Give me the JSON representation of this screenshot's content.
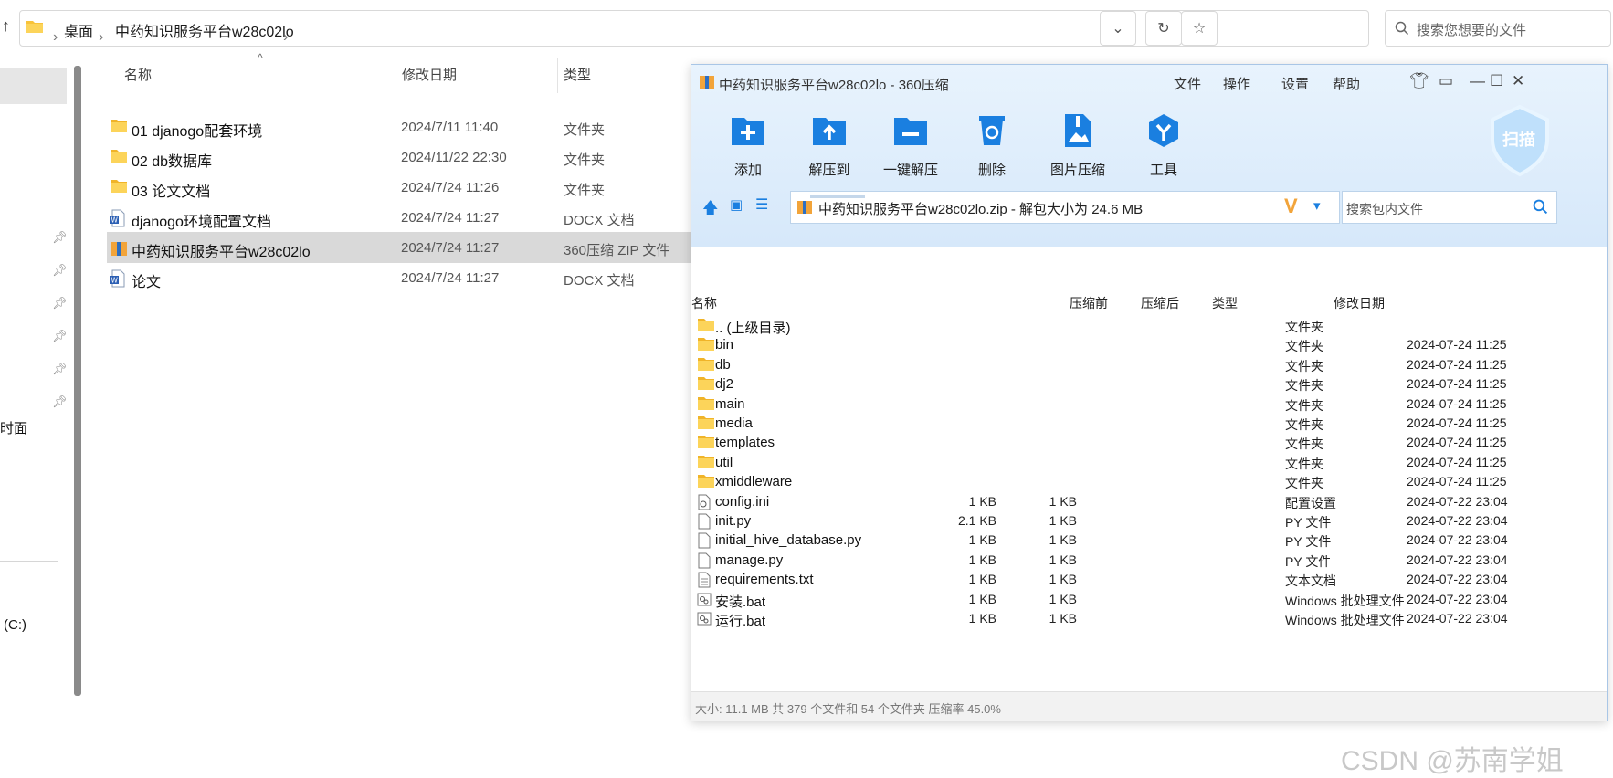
{
  "explorer": {
    "breadcrumb": [
      "桌面",
      "中药知识服务平台w28c02lo"
    ],
    "search_placeholder": "搜索您想要的文件",
    "columns": {
      "name": "名称",
      "date": "修改日期",
      "type": "类型"
    },
    "files": [
      {
        "name": "01 djanogo配套环境",
        "date": "2024/7/11 11:40",
        "type": "文件夹",
        "icon": "folder-icon"
      },
      {
        "name": "02 db数据库",
        "date": "2024/11/22 22:30",
        "type": "文件夹",
        "icon": "folder-icon"
      },
      {
        "name": "03 论文文档",
        "date": "2024/7/24 11:26",
        "type": "文件夹",
        "icon": "folder-icon"
      },
      {
        "name": "djanogo环境配置文档",
        "date": "2024/7/24 11:27",
        "type": "DOCX 文档",
        "icon": "word-doc-icon"
      },
      {
        "name": "中药知识服务平台w28c02lo",
        "date": "2024/7/24 11:27",
        "type": "360压缩 ZIP 文件",
        "icon": "zip-archive-icon",
        "selected": true
      },
      {
        "name": "论文",
        "date": "2024/7/24 11:27",
        "type": "DOCX 文档",
        "icon": "word-doc-icon"
      }
    ],
    "sidebar_fragments": [
      "时面",
      "(C:)"
    ]
  },
  "zip": {
    "title": "中药知识服务平台w28c02lo - 360压缩",
    "menu": [
      "文件",
      "操作",
      "设置",
      "帮助"
    ],
    "tools": [
      {
        "label": "添加",
        "icon": "add-icon"
      },
      {
        "label": "解压到",
        "icon": "extract-to-icon"
      },
      {
        "label": "一键解压",
        "icon": "one-click-extract-icon"
      },
      {
        "label": "删除",
        "icon": "delete-icon"
      },
      {
        "label": "图片压缩",
        "icon": "image-compress-icon"
      },
      {
        "label": "工具",
        "icon": "tools-icon"
      }
    ],
    "scan_label": "扫描",
    "path_text": "中药知识服务平台w28c02lo.zip - 解包大小为 24.6 MB",
    "search_placeholder": "搜索包内文件",
    "columns": {
      "name": "名称",
      "before": "压缩前",
      "after": "压缩后",
      "type": "类型",
      "date": "修改日期"
    },
    "entries": [
      {
        "name": ".. (上级目录)",
        "before": "",
        "after": "",
        "type": "文件夹",
        "date": "",
        "icon": "folder-icon"
      },
      {
        "name": "bin",
        "before": "",
        "after": "",
        "type": "文件夹",
        "date": "2024-07-24 11:25",
        "icon": "folder-icon"
      },
      {
        "name": "db",
        "before": "",
        "after": "",
        "type": "文件夹",
        "date": "2024-07-24 11:25",
        "icon": "folder-icon"
      },
      {
        "name": "dj2",
        "before": "",
        "after": "",
        "type": "文件夹",
        "date": "2024-07-24 11:25",
        "icon": "folder-icon"
      },
      {
        "name": "main",
        "before": "",
        "after": "",
        "type": "文件夹",
        "date": "2024-07-24 11:25",
        "icon": "folder-icon"
      },
      {
        "name": "media",
        "before": "",
        "after": "",
        "type": "文件夹",
        "date": "2024-07-24 11:25",
        "icon": "folder-icon"
      },
      {
        "name": "templates",
        "before": "",
        "after": "",
        "type": "文件夹",
        "date": "2024-07-24 11:25",
        "icon": "folder-icon"
      },
      {
        "name": "util",
        "before": "",
        "after": "",
        "type": "文件夹",
        "date": "2024-07-24 11:25",
        "icon": "folder-icon"
      },
      {
        "name": "xmiddleware",
        "before": "",
        "after": "",
        "type": "文件夹",
        "date": "2024-07-24 11:25",
        "icon": "folder-icon"
      },
      {
        "name": "config.ini",
        "before": "1 KB",
        "after": "1 KB",
        "type": "配置设置",
        "date": "2024-07-22 23:04",
        "icon": "settings-file-icon"
      },
      {
        "name": "init.py",
        "before": "2.1 KB",
        "after": "1 KB",
        "type": "PY 文件",
        "date": "2024-07-22 23:04",
        "icon": "file-icon"
      },
      {
        "name": "initial_hive_database.py",
        "before": "1 KB",
        "after": "1 KB",
        "type": "PY 文件",
        "date": "2024-07-22 23:04",
        "icon": "file-icon"
      },
      {
        "name": "manage.py",
        "before": "1 KB",
        "after": "1 KB",
        "type": "PY 文件",
        "date": "2024-07-22 23:04",
        "icon": "file-icon"
      },
      {
        "name": "requirements.txt",
        "before": "1 KB",
        "after": "1 KB",
        "type": "文本文档",
        "date": "2024-07-22 23:04",
        "icon": "text-file-icon"
      },
      {
        "name": "安装.bat",
        "before": "1 KB",
        "after": "1 KB",
        "type": "Windows 批处理文件",
        "date": "2024-07-22 23:04",
        "icon": "batch-file-icon"
      },
      {
        "name": "运行.bat",
        "before": "1 KB",
        "after": "1 KB",
        "type": "Windows 批处理文件",
        "date": "2024-07-22 23:04",
        "icon": "batch-file-icon"
      }
    ],
    "status": "大小: 11.1 MB 共 379 个文件和 54 个文件夹 压缩率 45.0%"
  },
  "watermark": "CSDN @苏南学姐",
  "colors": {
    "accent_blue": "#1e88e5",
    "folder_yellow": "#f8c33a",
    "selection_gray": "#d9d9d9",
    "zip_header": "#dbeafb"
  }
}
